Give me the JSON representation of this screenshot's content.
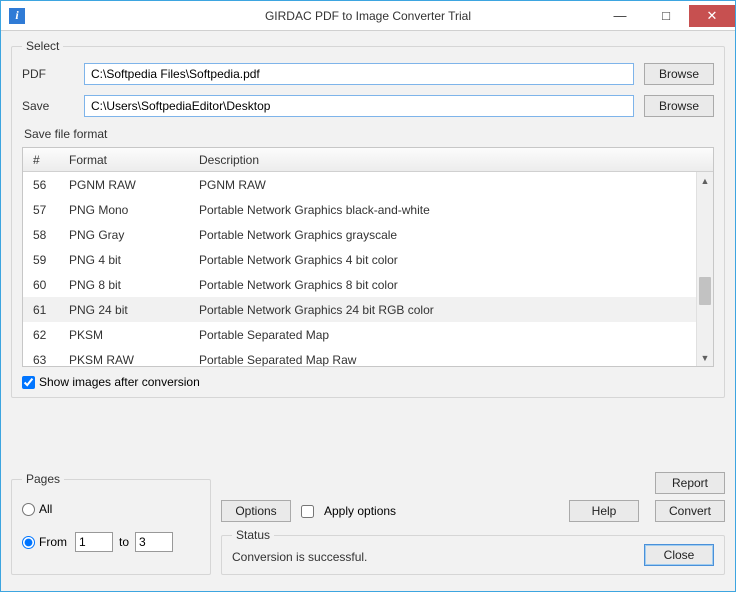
{
  "titlebar": {
    "title": "GIRDAC PDF to Image Converter Trial",
    "icon_letter": "i"
  },
  "select": {
    "legend": "Select",
    "pdf_label": "PDF",
    "pdf_value": "C:\\Softpedia Files\\Softpedia.pdf",
    "save_label": "Save",
    "save_value": "C:\\Users\\SoftpediaEditor\\Desktop",
    "browse_label": "Browse",
    "format_label": "Save file format",
    "columns": {
      "num": "#",
      "format": "Format",
      "description": "Description"
    },
    "rows": [
      {
        "num": "56",
        "format": "PGNM RAW",
        "desc": "PGNM RAW"
      },
      {
        "num": "57",
        "format": "PNG Mono",
        "desc": "Portable Network Graphics black-and-white"
      },
      {
        "num": "58",
        "format": "PNG Gray",
        "desc": "Portable Network Graphics grayscale"
      },
      {
        "num": "59",
        "format": "PNG 4 bit",
        "desc": "Portable Network Graphics 4 bit color"
      },
      {
        "num": "60",
        "format": "PNG 8 bit",
        "desc": "Portable Network Graphics 8 bit color"
      },
      {
        "num": "61",
        "format": "PNG 24 bit",
        "desc": "Portable Network Graphics 24 bit RGB color",
        "selected": true
      },
      {
        "num": "62",
        "format": "PKSM",
        "desc": "Portable Separated Map"
      },
      {
        "num": "63",
        "format": "PKSM RAW",
        "desc": "Portable Separated Map Raw"
      }
    ],
    "show_images_label": "Show images after conversion",
    "show_images_checked": true
  },
  "pages": {
    "legend": "Pages",
    "all_label": "All",
    "from_label": "From",
    "to_label": "to",
    "from_value": "1",
    "to_value": "3",
    "from_selected": true
  },
  "buttons": {
    "options": "Options",
    "apply_options": "Apply options",
    "report": "Report",
    "help": "Help",
    "convert": "Convert",
    "close": "Close"
  },
  "status": {
    "legend": "Status",
    "message": "Conversion is successful."
  }
}
